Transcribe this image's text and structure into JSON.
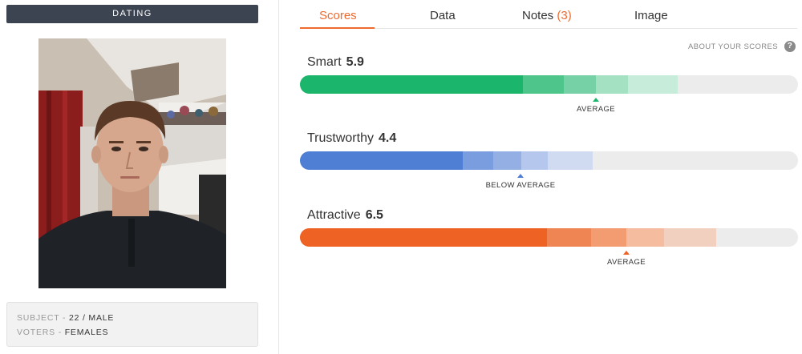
{
  "category": "DATING",
  "subject": {
    "label": "SUBJECT -",
    "value": "22 / MALE"
  },
  "voters": {
    "label": "VOTERS -",
    "value": "FEMALES"
  },
  "tabs": {
    "scores": "Scores",
    "data": "Data",
    "notes": "Notes",
    "notes_count": "(3)",
    "image": "Image"
  },
  "about_scores": "ABOUT YOUR SCORES",
  "help_glyph": "?",
  "scores": [
    {
      "label": "Smart",
      "value": "5.9",
      "rating": "AVERAGE",
      "color": "#1bb56c"
    },
    {
      "label": "Trustworthy",
      "value": "4.4",
      "rating": "BELOW AVERAGE",
      "color": "#4e7fd4"
    },
    {
      "label": "Attractive",
      "value": "6.5",
      "rating": "AVERAGE",
      "color": "#ee6223"
    }
  ]
}
